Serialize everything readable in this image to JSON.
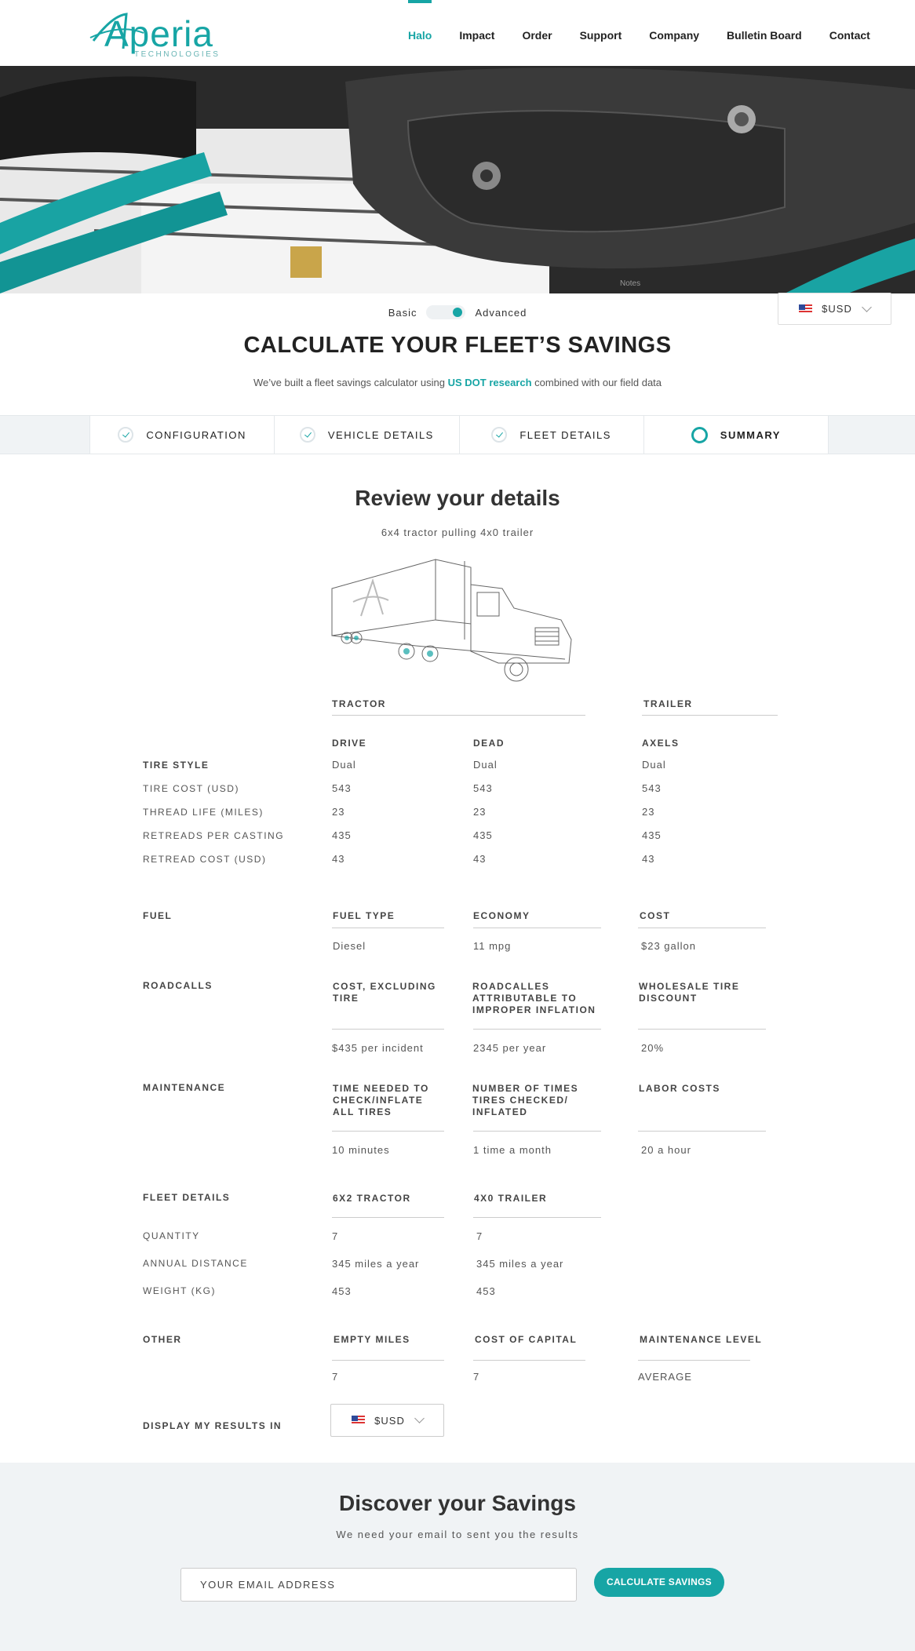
{
  "brand": {
    "logo_text": "Aperia",
    "logo_subtext": "TECHNOLOGIES"
  },
  "nav": [
    "Halo",
    "Impact",
    "Order",
    "Support",
    "Company",
    "Bulletin Board",
    "Contact"
  ],
  "nav_active": "Halo",
  "mode_toggle": {
    "left": "Basic",
    "right": "Advanced",
    "selected": "Advanced"
  },
  "currency": {
    "label": "$USD",
    "icon": "us-flag-icon"
  },
  "page_title": "CALCULATE YOUR FLEET’S SAVINGS",
  "intro": {
    "before": "We’ve built a fleet savings calculator using ",
    "link": "US DOT research",
    "after": " combined with our field data"
  },
  "steps": [
    {
      "label": "CONFIGURATION",
      "state": "done"
    },
    {
      "label": "VEHICLE DETAILS",
      "state": "done"
    },
    {
      "label": "FLEET DETAILS",
      "state": "done"
    },
    {
      "label": "SUMMARY",
      "state": "current"
    }
  ],
  "review": {
    "title": "Review your details",
    "subtitle": "6x4 tractor pulling 4x0 trailer"
  },
  "tires": {
    "group_tractor": "TRACTOR",
    "group_trailer": "TRAILER",
    "columns": [
      "DRIVE",
      "DEAD",
      "AXELS"
    ],
    "rows": [
      {
        "label": "TIRE STYLE",
        "bold": true,
        "values": [
          "Dual",
          "Dual",
          "Dual"
        ]
      },
      {
        "label": "TIRE COST (USD)",
        "values": [
          "543",
          "543",
          "543"
        ]
      },
      {
        "label": "THREAD LIFE (MILES)",
        "values": [
          "23",
          "23",
          "23"
        ]
      },
      {
        "label": "RETREADS PER CASTING",
        "values": [
          "435",
          "435",
          "435"
        ]
      },
      {
        "label": "RETREAD COST (USD)",
        "values": [
          "43",
          "43",
          "43"
        ]
      }
    ]
  },
  "fuel": {
    "label": "FUEL",
    "headers": [
      "FUEL TYPE",
      "ECONOMY",
      "COST"
    ],
    "values": [
      "Diesel",
      "11 mpg",
      "$23 gallon"
    ]
  },
  "roadcalls": {
    "label": "ROADCALLS",
    "headers": [
      "COST, EXCLUDING TIRE",
      "ROADCALLES ATTRIBUTABLE TO IMPROPER INFLATION",
      "WHOLESALE TIRE DISCOUNT"
    ],
    "values": [
      "$435 per incident",
      "2345 per year",
      "20%"
    ]
  },
  "maintenance": {
    "label": "MAINTENANCE",
    "headers": [
      "TIME NEEDED TO CHECK/INFLATE ALL TIRES",
      "NUMBER OF TIMES TIRES CHECKED/ INFLATED",
      "LABOR COSTS"
    ],
    "values": [
      "10 minutes",
      "1 time a month",
      "20 a hour"
    ]
  },
  "fleet": {
    "label": "FLEET DETAILS",
    "headers": [
      "6X2 TRACTOR",
      "4X0 TRAILER"
    ],
    "rows": [
      {
        "label": "QUANTITY",
        "values": [
          "7",
          "7"
        ]
      },
      {
        "label": "ANNUAL DISTANCE",
        "values": [
          "345 miles a year",
          "345 miles a year"
        ]
      },
      {
        "label": "WEIGHT (KG)",
        "values": [
          "453",
          "453"
        ]
      }
    ]
  },
  "other": {
    "label": "OTHER",
    "headers": [
      "EMPTY MILES",
      "COST OF CAPITAL",
      "MAINTENANCE LEVEL"
    ],
    "values": [
      "7",
      "7",
      "AVERAGE"
    ]
  },
  "display_results": {
    "label": "DISPLAY MY RESULTS IN",
    "currency": "$USD"
  },
  "discover": {
    "title": "Discover your Savings",
    "subtitle": "We need your email to sent you the results",
    "email_placeholder": "YOUR EMAIL ADDRESS",
    "button": "CALCULATE SAVINGS"
  },
  "colors": {
    "accent": "#17a5a5",
    "band": "#f0f3f5"
  }
}
